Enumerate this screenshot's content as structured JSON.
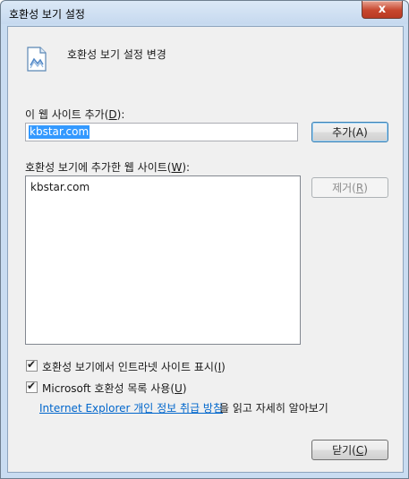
{
  "window": {
    "title": "호환성 보기 설정",
    "close_glyph": "x"
  },
  "header": {
    "text": "호환성 보기 설정 변경"
  },
  "add_site": {
    "label_prefix": "이 웹 사이트 추가(",
    "label_key": "D",
    "label_suffix": "):",
    "input_value": "kbstar.com",
    "add_button": "추가(A)"
  },
  "site_list": {
    "label_prefix": "호환성 보기에 추가한 웹 사이트(",
    "label_key": "W",
    "label_suffix": "):",
    "items": [
      "kbstar.com"
    ],
    "remove_prefix": "제거(",
    "remove_key": "R",
    "remove_suffix": ")"
  },
  "options": {
    "intranet_prefix": "호환성 보기에서 인트라넷 사이트 표시(",
    "intranet_key": "I",
    "intranet_suffix": ")",
    "intranet_checked": true,
    "ms_list_prefix": "Microsoft 호환성 목록 사용(",
    "ms_list_key": "U",
    "ms_list_suffix": ")",
    "ms_list_checked": true
  },
  "privacy": {
    "link_text": "Internet Explorer 개인 정보 취급 방침",
    "suffix_text": "을 읽고 자세히 알아보기"
  },
  "footer": {
    "close_prefix": "닫기(",
    "close_key": "C",
    "close_suffix": ")"
  }
}
